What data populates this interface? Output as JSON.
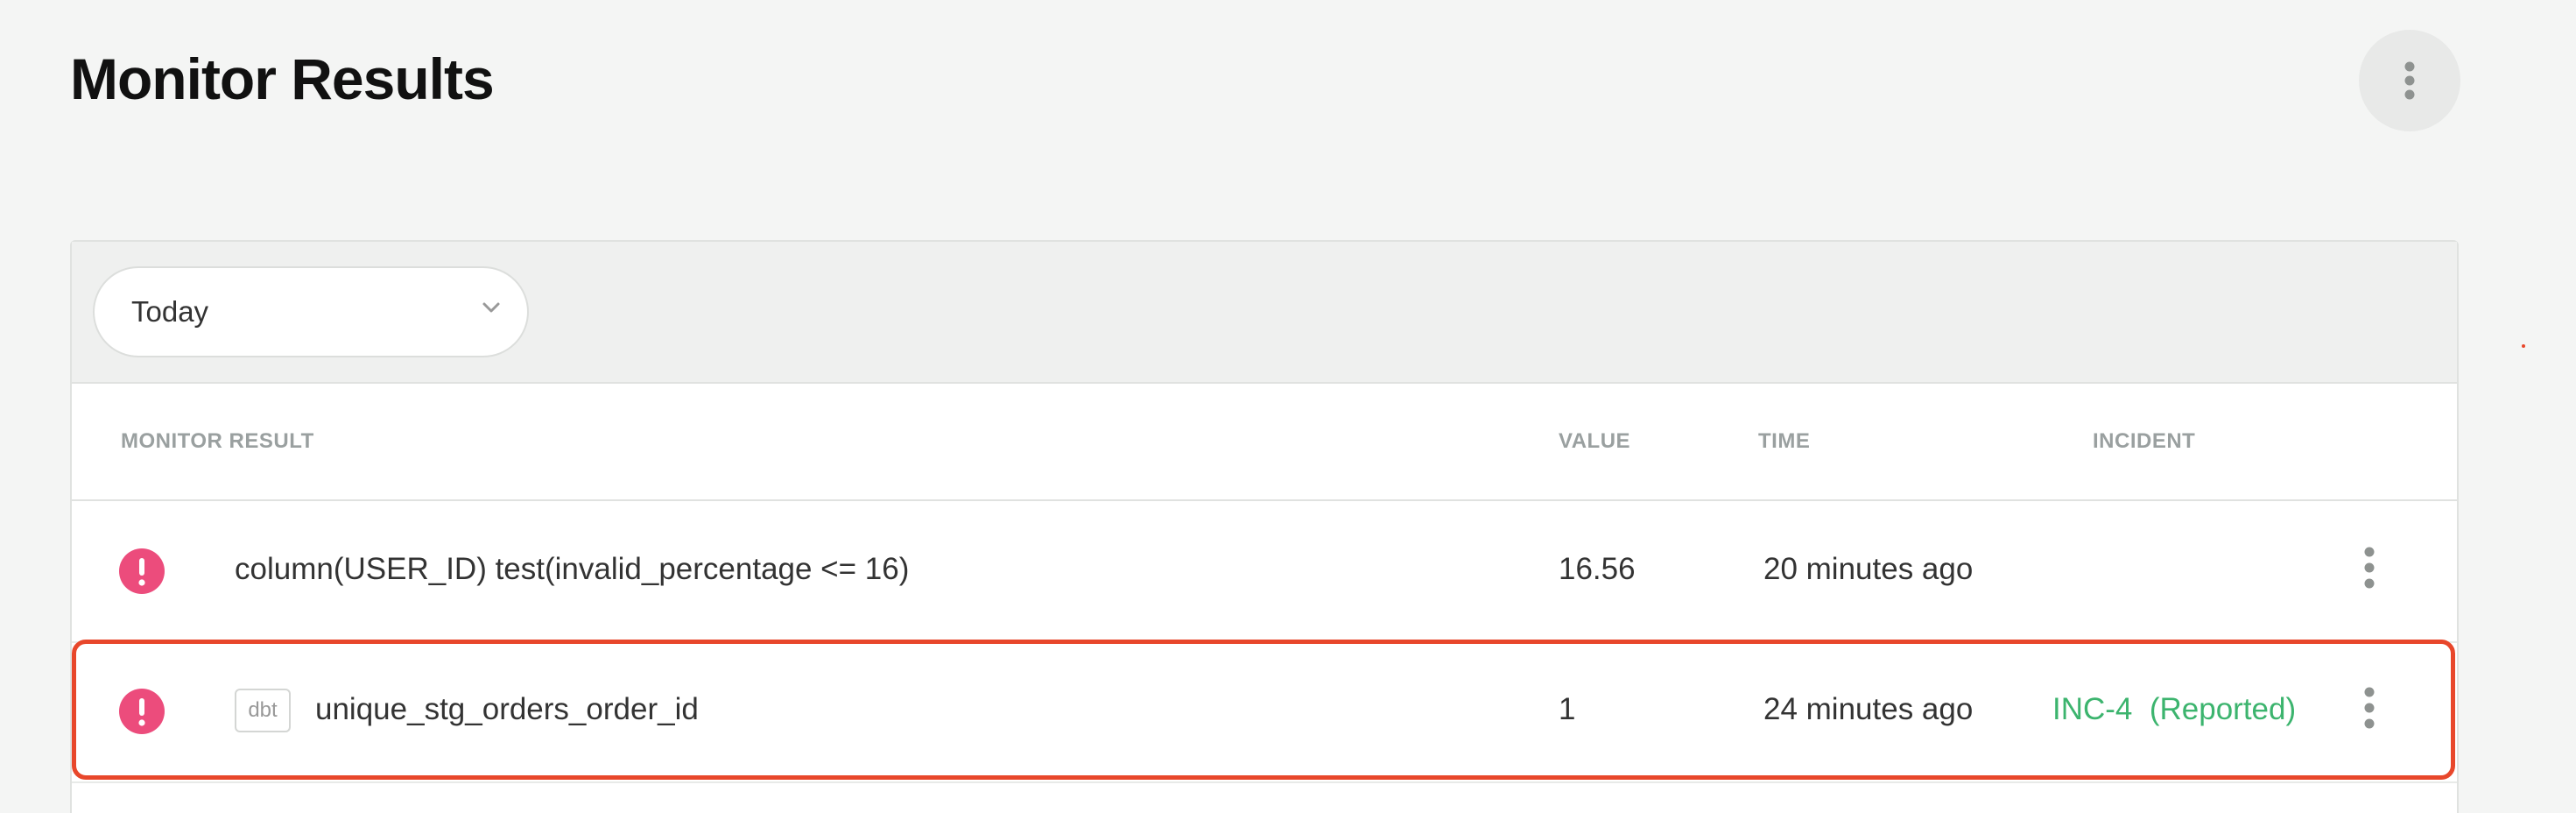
{
  "page": {
    "title": "Monitor Results"
  },
  "filter": {
    "date_range": "Today"
  },
  "table": {
    "columns": {
      "monitor_result": "MONITOR RESULT",
      "value": "VALUE",
      "time": "TIME",
      "incident": "INCIDENT"
    },
    "rows": [
      {
        "status": "alert",
        "source_badge": "",
        "name": "column(USER_ID) test(invalid_percentage <= 16)",
        "value": "16.56",
        "time": "20 minutes ago",
        "incident": ""
      },
      {
        "status": "alert",
        "source_badge": "dbt",
        "name": "unique_stg_orders_order_id",
        "value": "1",
        "time": "24 minutes ago",
        "incident": "INC-4  (Reported)"
      }
    ]
  },
  "colors": {
    "alert": "#ec4c7c",
    "incident_link": "#3cb46e",
    "highlight": "#e8472b"
  }
}
